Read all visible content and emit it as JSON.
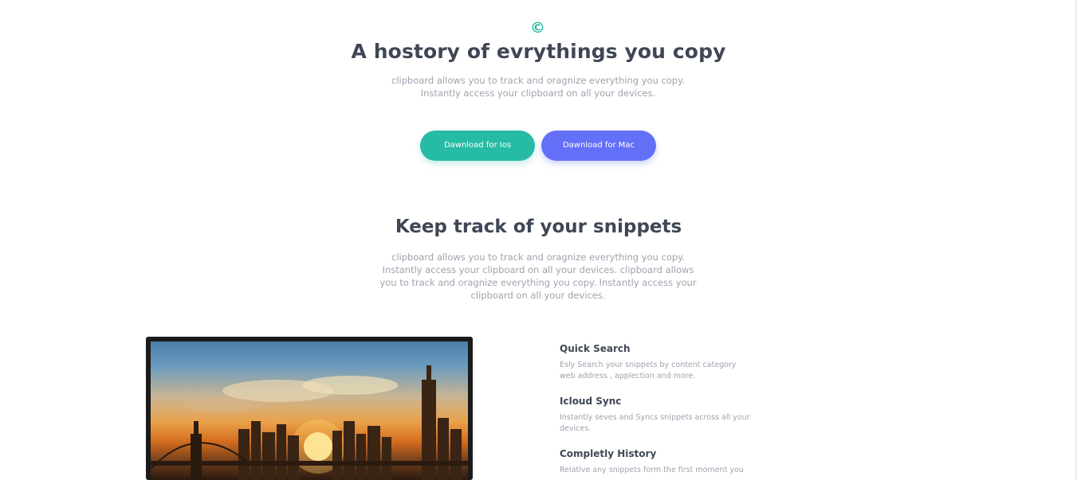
{
  "hero": {
    "logo_glyph": "©",
    "title": "A hostory of evrythings you copy",
    "subtitle_line1": "clipboard allows you to track and oragnize everything you copy.",
    "subtitle_line2": "Instantly access your clipboard on all your devices."
  },
  "buttons": {
    "ios_label": "Dawnload for Ios",
    "mac_label": "Dawnload for Mac"
  },
  "snippets": {
    "title": "Keep track of your snippets",
    "description": "clipboard allows you to track and oragnize everything you copy. Instantly access your clipboard on all your devices. clipboard allows you to track and oragnize everything you copy. Instantly access your clipboard on all your devices."
  },
  "features": [
    {
      "title": "Quick Search",
      "text": "Esly Search your snippets by content category web address , applection and more."
    },
    {
      "title": "Icloud Sync",
      "text": "Instantly seves and Syncs snippets across all your devices."
    },
    {
      "title": "Completly History",
      "text": "Relative any snippets form the first moment you"
    }
  ],
  "colors": {
    "accent_green": "#26bba4",
    "accent_blue": "#6470f7",
    "heading": "#3f4755",
    "muted": "#9ea3ad"
  },
  "icons": {
    "logo": "copyright-icon"
  }
}
